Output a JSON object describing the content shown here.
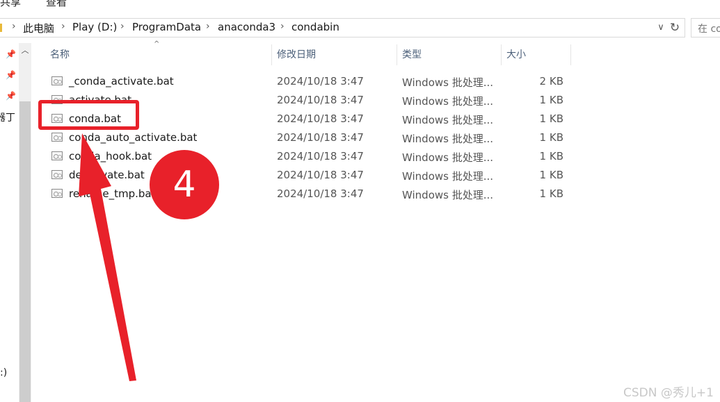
{
  "menubar": {
    "share": "共享",
    "view": "查看"
  },
  "address": {
    "breadcrumbs": [
      "此电脑",
      "Play (D:)",
      "ProgramData",
      "anaconda3",
      "condabin"
    ],
    "separator": "›",
    "dropdown_icon": "∨",
    "refresh_icon": "↻"
  },
  "search": {
    "placeholder": "在 co"
  },
  "navpane": {
    "frag_label": "器丁",
    "drive_frag": ":)",
    "pin_icon": "📌",
    "scroll_up_icon": "︿"
  },
  "columns": {
    "name": "名称",
    "modified": "修改日期",
    "type": "类型",
    "size": "大小",
    "sort_icon": "^"
  },
  "files": [
    {
      "name": "_conda_activate.bat",
      "modified": "2024/10/18 3:47",
      "type": "Windows 批处理...",
      "size": "2 KB"
    },
    {
      "name": "activate.bat",
      "modified": "2024/10/18 3:47",
      "type": "Windows 批处理...",
      "size": "1 KB"
    },
    {
      "name": "conda.bat",
      "modified": "2024/10/18 3:47",
      "type": "Windows 批处理...",
      "size": "1 KB"
    },
    {
      "name": "conda_auto_activate.bat",
      "modified": "2024/10/18 3:47",
      "type": "Windows 批处理...",
      "size": "1 KB"
    },
    {
      "name": "conda_hook.bat",
      "modified": "2024/10/18 3:47",
      "type": "Windows 批处理...",
      "size": "1 KB"
    },
    {
      "name": "deactivate.bat",
      "modified": "2024/10/18 3:47",
      "type": "Windows 批处理...",
      "size": "1 KB"
    },
    {
      "name": "rename_tmp.bat",
      "modified": "2024/10/18 3:47",
      "type": "Windows 批处理...",
      "size": "1 KB"
    }
  ],
  "annotation": {
    "step_number": "4",
    "color": "#e8212a"
  },
  "watermark": "CSDN @秀儿+1"
}
